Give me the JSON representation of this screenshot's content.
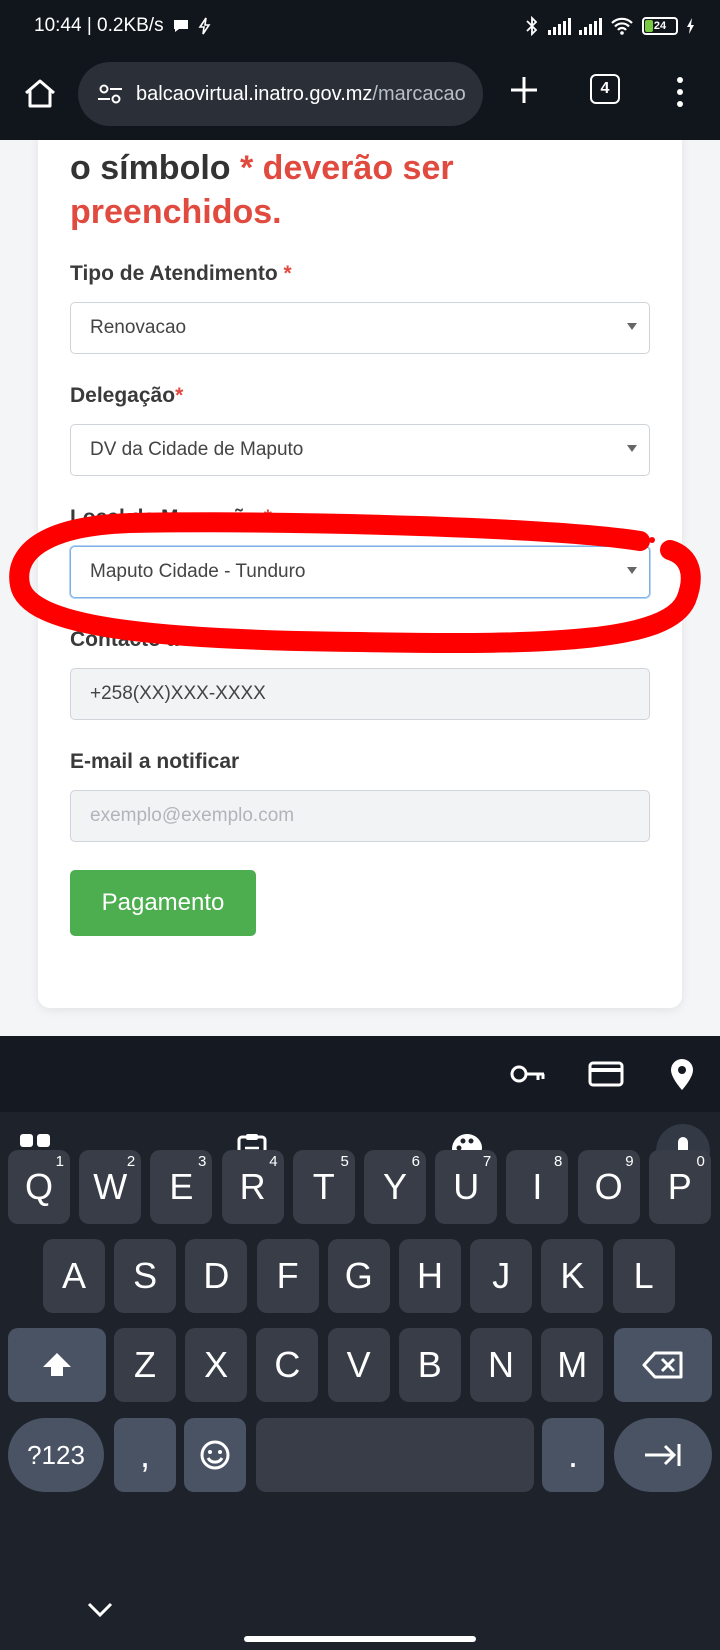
{
  "status": {
    "time_speed": "10:44 | 0.2KB/s",
    "battery": "24"
  },
  "browser": {
    "url_host": "balcaovirtual.inatro.gov.mz",
    "url_path": "/marcacao",
    "tab_count": "4"
  },
  "form": {
    "notice_pre": "o símbolo ",
    "notice_red": "* deverão ser preenchidos.",
    "fields": [
      {
        "label": "Tipo de Atendimento ",
        "required": "*",
        "value": "Renovacao"
      },
      {
        "label": "Delegação",
        "required": "*",
        "value": "DV da Cidade de Maputo"
      },
      {
        "label": "Local da Marcação ",
        "required": "*",
        "value": "Maputo Cidade - Tunduro"
      },
      {
        "label": "Contacto a notificar ",
        "required": "*",
        "value": "+258(XX)XXX-XXXX"
      },
      {
        "label": "E-mail a notificar",
        "placeholder": "exemplo@exemplo.com"
      }
    ],
    "submit_label": "Pagamento"
  },
  "keyboard": {
    "row1": [
      [
        "Q",
        "1"
      ],
      [
        "W",
        "2"
      ],
      [
        "E",
        "3"
      ],
      [
        "R",
        "4"
      ],
      [
        "T",
        "5"
      ],
      [
        "Y",
        "6"
      ],
      [
        "U",
        "7"
      ],
      [
        "I",
        "8"
      ],
      [
        "O",
        "9"
      ],
      [
        "P",
        "0"
      ]
    ],
    "row2": [
      "A",
      "S",
      "D",
      "F",
      "G",
      "H",
      "J",
      "K",
      "L"
    ],
    "row3": [
      "Z",
      "X",
      "C",
      "V",
      "B",
      "N",
      "M"
    ],
    "symbols_label": "?123",
    "comma_label": ",",
    "period_label": "."
  },
  "colors": {
    "required_red": "#e04a3f",
    "pay_green": "#4cae4f",
    "annotation_red": "#ff0000"
  }
}
